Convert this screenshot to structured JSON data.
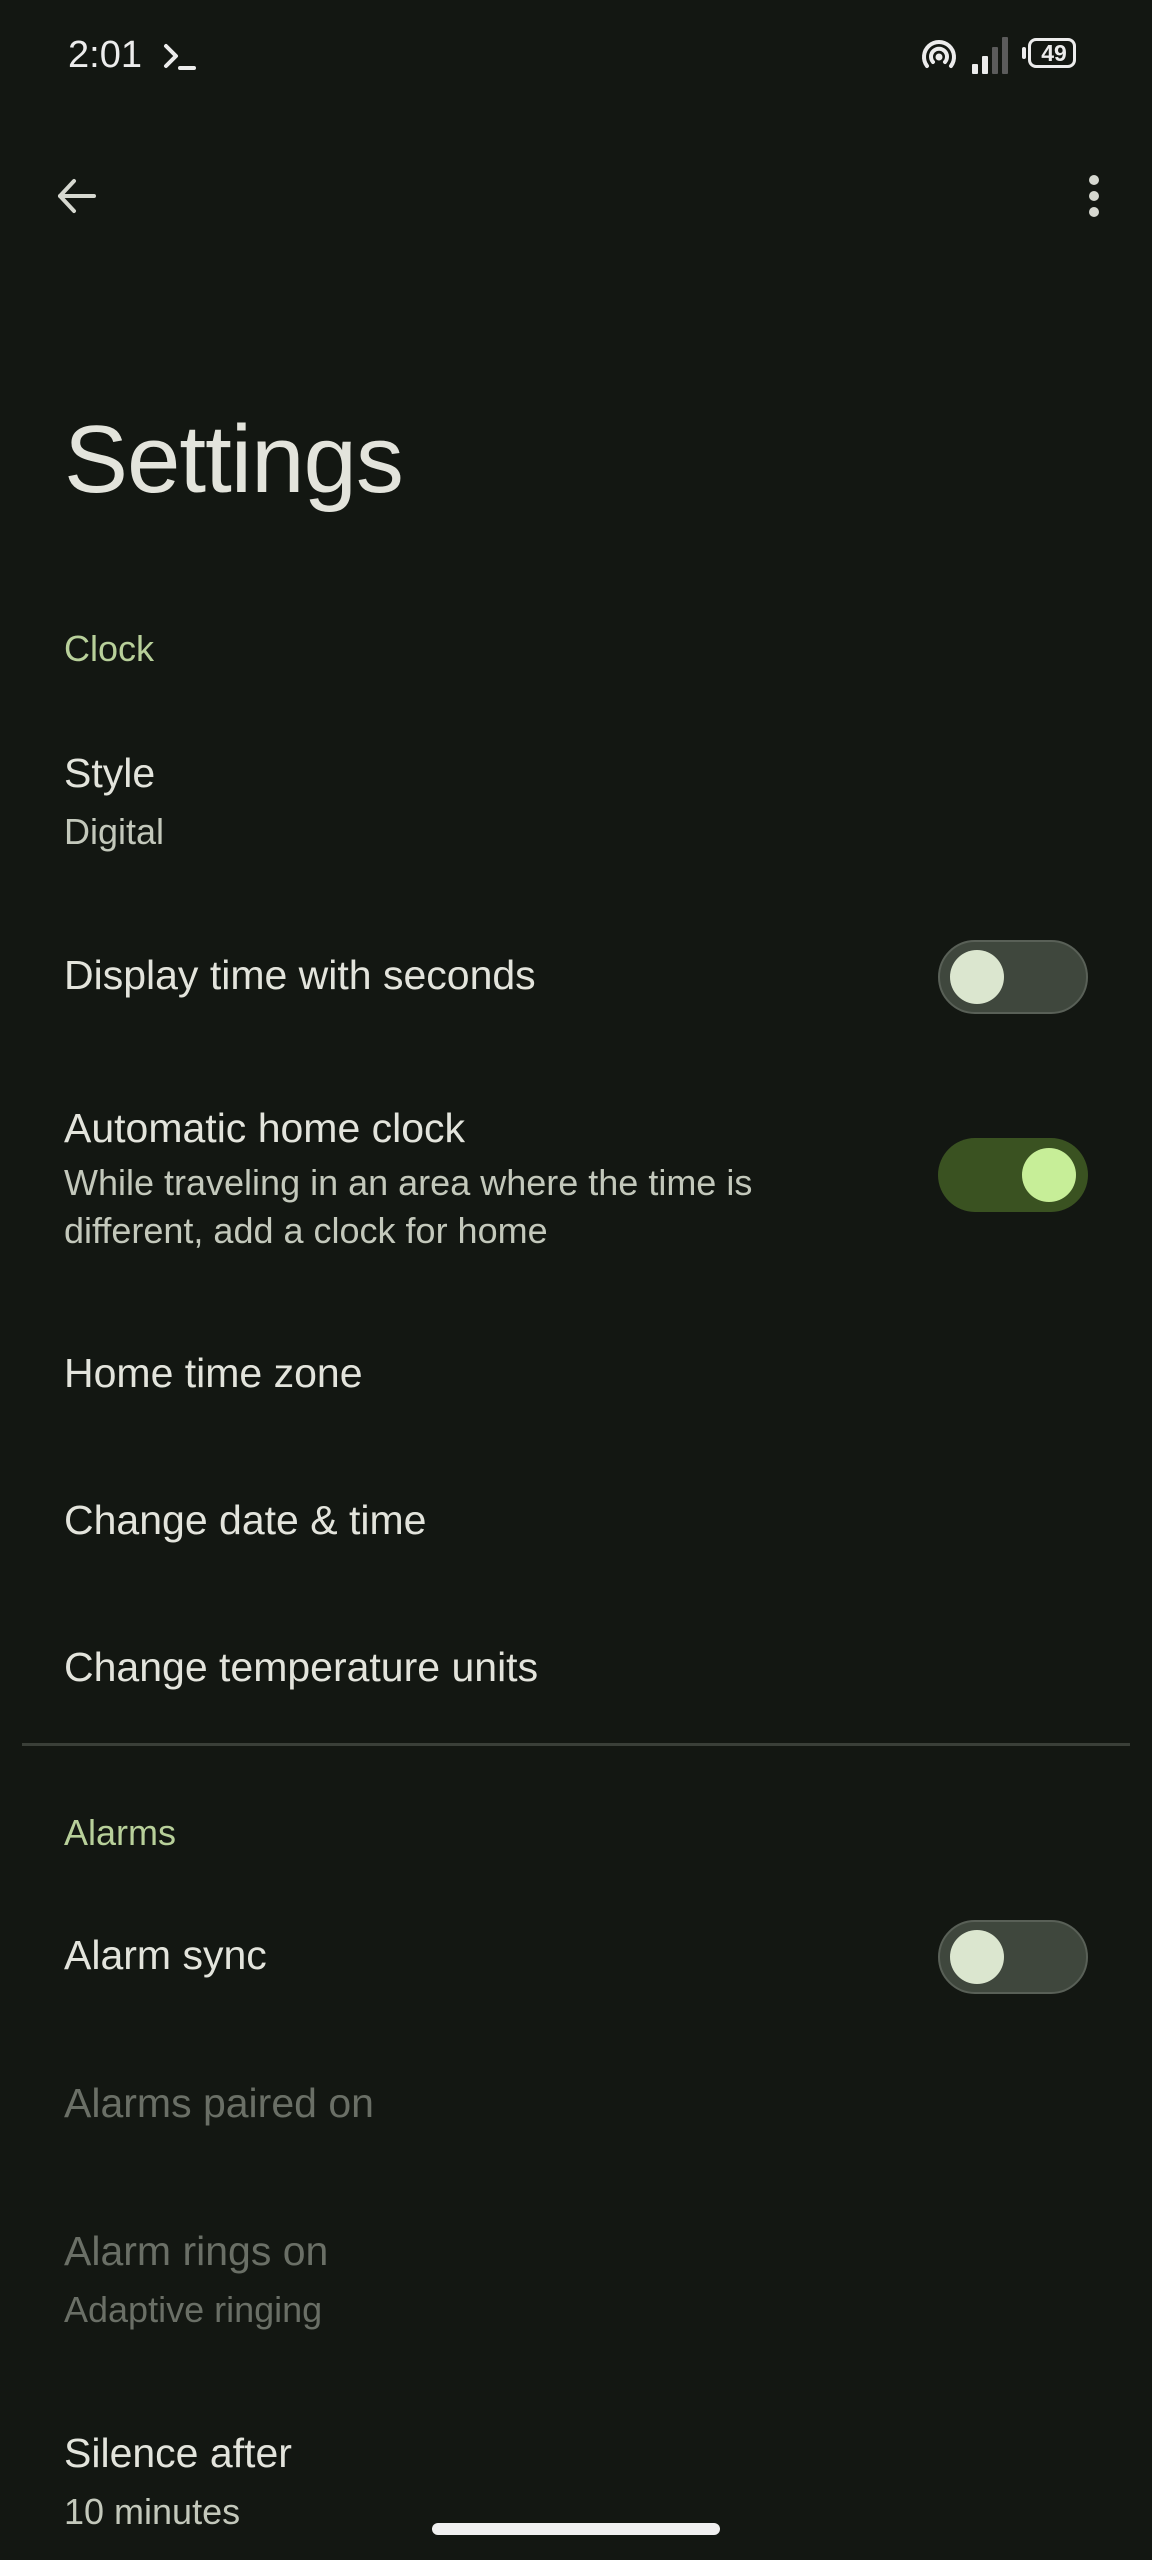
{
  "status_bar": {
    "time": "2:01",
    "battery_level": "49",
    "icons": [
      "terminal-icon",
      "hotspot-icon",
      "signal-icon",
      "battery-icon"
    ]
  },
  "toolbar": {
    "back_icon": "arrow-back-icon",
    "more_icon": "more-vert-icon"
  },
  "page": {
    "title": "Settings"
  },
  "sections": {
    "clock": {
      "header": "Clock",
      "style": {
        "title": "Style",
        "value": "Digital"
      },
      "seconds": {
        "title": "Display time with seconds",
        "enabled": false
      },
      "auto_home": {
        "title": "Automatic home clock",
        "description_line1": "While traveling in an area where the time is",
        "description_line2": "different, add a clock for home",
        "enabled": true
      },
      "home_zone": {
        "title": "Home time zone"
      },
      "date_time": {
        "title": "Change date & time"
      },
      "temperature": {
        "title": "Change temperature units"
      }
    },
    "alarms": {
      "header": "Alarms",
      "sync": {
        "title": "Alarm sync",
        "enabled": false
      },
      "paired": {
        "title": "Alarms paired on"
      },
      "rings": {
        "title": "Alarm rings on",
        "value": "Adaptive ringing"
      },
      "silence": {
        "title": "Silence after",
        "value": "10 minutes"
      }
    }
  },
  "colors": {
    "background": "#131712",
    "accent": "#b8d09a",
    "switch_on_track": "#3a5221",
    "switch_on_thumb": "#c7ee98",
    "switch_off_track": "#3f473d",
    "switch_off_thumb": "#dbe6cf"
  }
}
